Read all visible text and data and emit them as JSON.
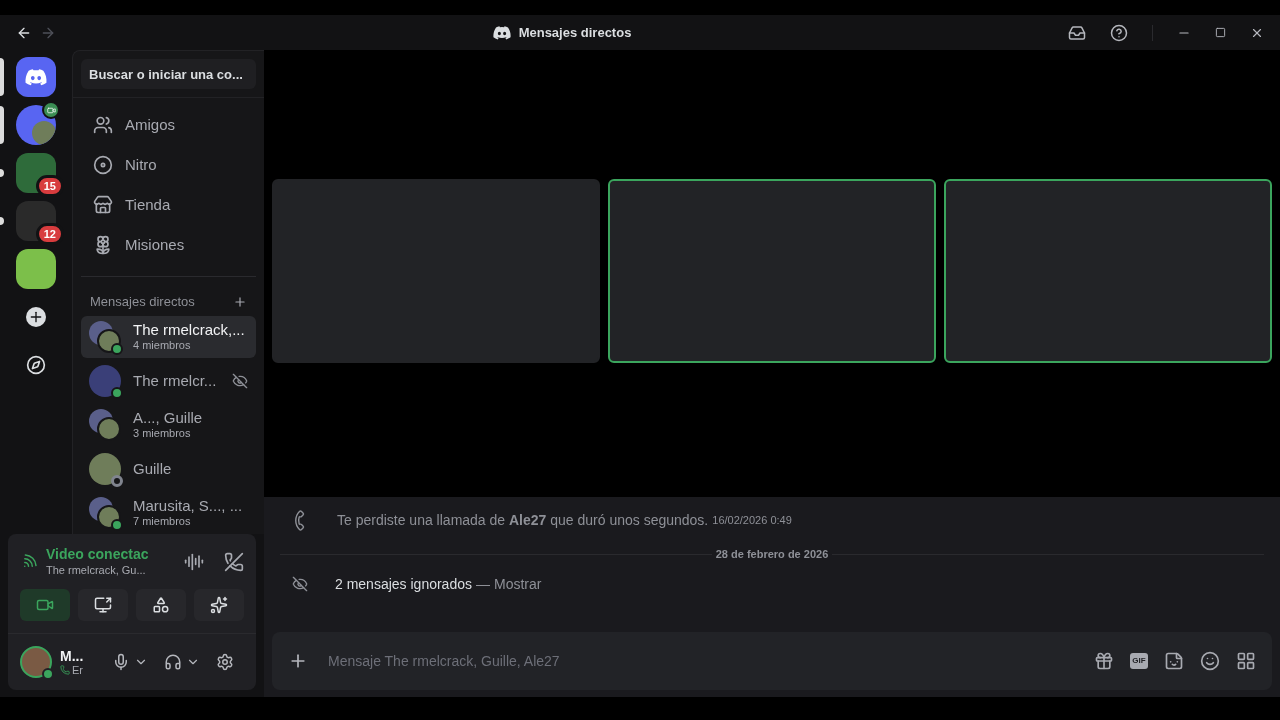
{
  "window": {
    "title": "Mensajes directos",
    "back_enabled": true,
    "forward_enabled": false
  },
  "servers": [
    {
      "kind": "home",
      "selected": true,
      "unread": false
    },
    {
      "kind": "dm",
      "selected": true,
      "unread": false,
      "video": true
    },
    {
      "kind": "server",
      "selected": false,
      "unread": true,
      "badge": "15",
      "color": "#2e6b3a"
    },
    {
      "kind": "server",
      "selected": false,
      "unread": true,
      "badge": "12",
      "color": "#2a2a2a"
    },
    {
      "kind": "server",
      "selected": false,
      "unread": false,
      "color": "#7cbf4a"
    },
    {
      "kind": "add",
      "selected": false,
      "unread": false
    },
    {
      "kind": "explore",
      "selected": false,
      "unread": false
    }
  ],
  "search": {
    "placeholder": "Buscar o iniciar una co..."
  },
  "nav": [
    {
      "kind": "friends",
      "label": "Amigos"
    },
    {
      "kind": "nitro",
      "label": "Nitro"
    },
    {
      "kind": "shop",
      "label": "Tienda"
    },
    {
      "kind": "quests",
      "label": "Misiones"
    }
  ],
  "dm_header": "Mensajes directos",
  "dms": [
    {
      "name": "The rmelcrack,...",
      "subtitle": "4 miembros",
      "selected": true,
      "online": true,
      "offline": false,
      "group": true,
      "ignored": false
    },
    {
      "name": "The rmelcr...",
      "selected": false,
      "online": true,
      "offline": false,
      "group": false,
      "ignored": true
    },
    {
      "name": "A..., Guille",
      "subtitle": "3 miembros",
      "selected": false,
      "online": false,
      "offline": false,
      "group": true,
      "ignored": false
    },
    {
      "name": "Guille",
      "selected": false,
      "online": false,
      "offline": true,
      "group": false,
      "ignored": false
    },
    {
      "name": "Marusita, S..., ...",
      "subtitle": "7 miembros",
      "selected": false,
      "online": true,
      "offline": false,
      "group": true,
      "ignored": false
    }
  ],
  "voice": {
    "status": "Video conectac",
    "channel": "The rmelcrack, Gu...",
    "buttons": [
      {
        "kind": "camera",
        "on": true
      },
      {
        "kind": "screen",
        "on": false
      },
      {
        "kind": "activities",
        "on": false
      },
      {
        "kind": "soundboard",
        "on": false
      }
    ]
  },
  "user": {
    "name": "M...",
    "status": "Er"
  },
  "tiles": [
    {
      "speaking": false
    },
    {
      "speaking": true
    },
    {
      "speaking": true
    }
  ],
  "messages": [
    {
      "kind": "call",
      "text": "Te perdiste una llamada de **Ale27** que duró unos segundos.",
      "time": "16/02/2026 0:49"
    },
    {
      "kind": "divider",
      "text": "28 de febrero de 2026"
    },
    {
      "kind": "ignored",
      "text": "2 mensajes ignorados",
      "separator": "—",
      "link": "Mostrar"
    }
  ],
  "composer": {
    "placeholder": "Mensaje The rmelcrack, Guille, Ale27",
    "buttons": [
      {
        "kind": "gift"
      },
      {
        "kind": "gif",
        "label": "GIF"
      },
      {
        "kind": "sticker"
      },
      {
        "kind": "emoji"
      },
      {
        "kind": "apps"
      }
    ]
  }
}
